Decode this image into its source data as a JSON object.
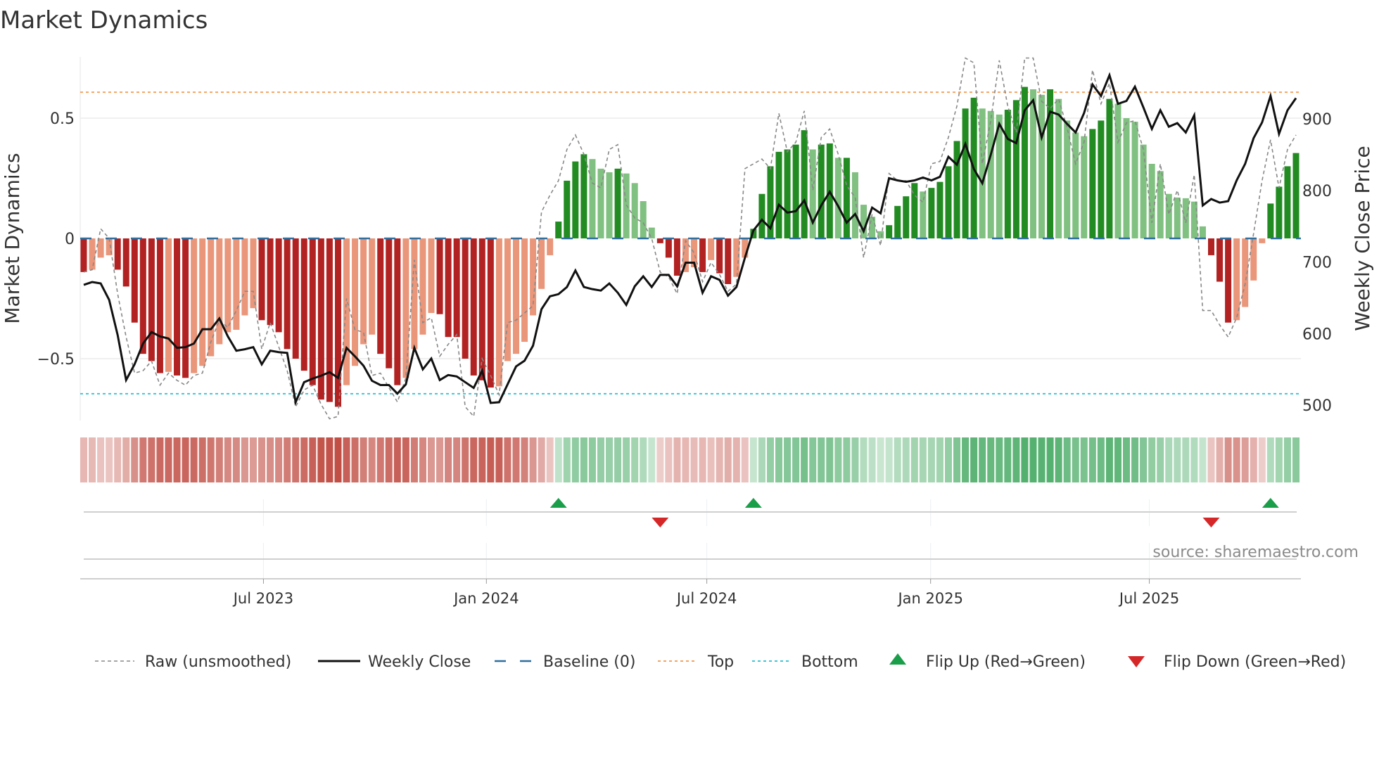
{
  "chart_data": {
    "type": "bar",
    "title": "Market Dynamics",
    "ylabel": "Market Dynamics",
    "y2label": "Weekly Close Price",
    "ylim": [
      -0.755,
      0.755
    ],
    "y2lim": [
      487,
      1035
    ],
    "yticks": [
      {
        "value": 0.5,
        "label": "0.5"
      },
      {
        "value": 0,
        "label": "0"
      },
      {
        "value": -0.5,
        "label": "−0.5"
      }
    ],
    "y2ticks": [
      {
        "value": 900,
        "label": "900"
      },
      {
        "value": 800,
        "label": "800"
      },
      {
        "value": 700,
        "label": "700"
      },
      {
        "value": 600,
        "label": "600"
      },
      {
        "value": 500,
        "label": "500"
      }
    ],
    "xticks": [
      {
        "week": 21.2,
        "label": "Jul 2023"
      },
      {
        "week": 47.5,
        "label": "Jan 2024"
      },
      {
        "week": 73.5,
        "label": "Jul 2024"
      },
      {
        "week": 99.9,
        "label": "Jan 2025"
      },
      {
        "week": 125.7,
        "label": "Jul 2025"
      }
    ],
    "top_level": 0.608,
    "bottom_level": -0.646,
    "baseline": 0,
    "values": [
      -0.14,
      -0.13,
      -0.08,
      -0.07,
      -0.13,
      -0.2,
      -0.35,
      -0.48,
      -0.51,
      -0.56,
      -0.555,
      -0.57,
      -0.58,
      -0.56,
      -0.53,
      -0.49,
      -0.44,
      -0.39,
      -0.38,
      -0.32,
      -0.29,
      -0.34,
      -0.36,
      -0.39,
      -0.46,
      -0.5,
      -0.55,
      -0.61,
      -0.67,
      -0.68,
      -0.7,
      -0.61,
      -0.53,
      -0.44,
      -0.4,
      -0.48,
      -0.54,
      -0.61,
      -0.58,
      -0.46,
      -0.4,
      -0.31,
      -0.315,
      -0.41,
      -0.41,
      -0.5,
      -0.57,
      -0.59,
      -0.62,
      -0.615,
      -0.51,
      -0.48,
      -0.43,
      -0.32,
      -0.21,
      -0.07,
      0.07,
      0.24,
      0.32,
      0.35,
      0.33,
      0.29,
      0.275,
      0.29,
      0.27,
      0.23,
      0.155,
      0.045,
      -0.02,
      -0.08,
      -0.155,
      -0.14,
      -0.12,
      -0.14,
      -0.09,
      -0.145,
      -0.19,
      -0.16,
      -0.08,
      0.04,
      0.185,
      0.3,
      0.36,
      0.37,
      0.39,
      0.45,
      0.37,
      0.39,
      0.395,
      0.335,
      0.335,
      0.275,
      0.14,
      0.09,
      0.03,
      0.055,
      0.135,
      0.175,
      0.23,
      0.195,
      0.21,
      0.235,
      0.3,
      0.405,
      0.54,
      0.585,
      0.54,
      0.53,
      0.515,
      0.535,
      0.575,
      0.63,
      0.62,
      0.597,
      0.62,
      0.58,
      0.49,
      0.44,
      0.425,
      0.455,
      0.49,
      0.58,
      0.56,
      0.5,
      0.485,
      0.39,
      0.31,
      0.28,
      0.185,
      0.17,
      0.167,
      0.153,
      0.05,
      -0.07,
      -0.18,
      -0.35,
      -0.34,
      -0.285,
      -0.175,
      -0.02,
      0.145,
      0.215,
      0.3,
      0.355
    ],
    "raw": [
      -0.14,
      -0.13,
      0.04,
      0.0,
      -0.23,
      -0.41,
      -0.56,
      -0.55,
      -0.51,
      -0.61,
      -0.56,
      -0.59,
      -0.61,
      -0.57,
      -0.56,
      -0.43,
      -0.34,
      -0.37,
      -0.3,
      -0.22,
      -0.22,
      -0.46,
      -0.35,
      -0.45,
      -0.55,
      -0.7,
      -0.63,
      -0.61,
      -0.69,
      -0.75,
      -0.74,
      -0.25,
      -0.38,
      -0.39,
      -0.57,
      -0.56,
      -0.62,
      -0.68,
      -0.58,
      -0.09,
      -0.35,
      -0.33,
      -0.49,
      -0.44,
      -0.4,
      -0.7,
      -0.74,
      -0.5,
      -0.57,
      -0.65,
      -0.35,
      -0.34,
      -0.31,
      -0.28,
      0.11,
      0.18,
      0.24,
      0.37,
      0.43,
      0.35,
      0.23,
      0.21,
      0.37,
      0.39,
      0.14,
      0.085,
      0.065,
      0.0,
      -0.14,
      -0.16,
      -0.23,
      -0.01,
      -0.06,
      -0.18,
      -0.1,
      -0.15,
      -0.22,
      -0.19,
      0.29,
      0.31,
      0.33,
      0.29,
      0.52,
      0.36,
      0.4,
      0.53,
      0.2,
      0.42,
      0.455,
      0.35,
      0.22,
      0.17,
      -0.08,
      0.1,
      -0.03,
      0.27,
      0.24,
      0.24,
      0.18,
      0.15,
      0.31,
      0.32,
      0.42,
      0.55,
      0.75,
      0.73,
      0.31,
      0.49,
      0.74,
      0.55,
      0.44,
      0.75,
      0.75,
      0.57,
      0.54,
      0.58,
      0.46,
      0.31,
      0.4,
      0.7,
      0.56,
      0.645,
      0.4,
      0.48,
      0.49,
      0.37,
      0.065,
      0.31,
      0.1,
      0.2,
      0.065,
      0.265,
      -0.3,
      -0.3,
      -0.36,
      -0.41,
      -0.33,
      -0.19,
      0.02,
      0.24,
      0.41,
      0.21,
      0.37,
      0.43
    ],
    "weekly_close": [
      668,
      672,
      670,
      647,
      598,
      535,
      557,
      586,
      602,
      596,
      593,
      580,
      581,
      586,
      606,
      606,
      621,
      596,
      576,
      578,
      581,
      557,
      576,
      574,
      573,
      504,
      532,
      537,
      541,
      546,
      538,
      580,
      568,
      555,
      534,
      528,
      528,
      516,
      529,
      580,
      550,
      565,
      535,
      542,
      540,
      532,
      524,
      548,
      503,
      504,
      529,
      554,
      562,
      583,
      634,
      652,
      655,
      665,
      688,
      665,
      662,
      660,
      670,
      657,
      640,
      666,
      680,
      665,
      682,
      682,
      666,
      699,
      699,
      657,
      680,
      675,
      653,
      665,
      706,
      744,
      759,
      747,
      780,
      769,
      771,
      786,
      755,
      779,
      798,
      778,
      755,
      767,
      743,
      776,
      768,
      817,
      814,
      812,
      814,
      818,
      814,
      819,
      847,
      836,
      865,
      830,
      810,
      850,
      893,
      872,
      866,
      912,
      926,
      874,
      910,
      906,
      893,
      881,
      908,
      948,
      932,
      961,
      921,
      925,
      945,
      916,
      886,
      912,
      889,
      894,
      881,
      905,
      779,
      788,
      783,
      785,
      814,
      837,
      873,
      895,
      932,
      879,
      912,
      929
    ],
    "flips": [
      {
        "week": 57,
        "type": "up"
      },
      {
        "week": 69,
        "type": "down"
      },
      {
        "week": 80,
        "type": "up"
      },
      {
        "week": 134,
        "type": "down"
      },
      {
        "week": 141,
        "type": "up"
      }
    ],
    "legend": {
      "placement": "bottom",
      "items": [
        {
          "key": "raw",
          "label": "Raw (unsmoothed)"
        },
        {
          "key": "close",
          "label": "Weekly Close"
        },
        {
          "key": "baseline",
          "label": "Baseline (0)"
        },
        {
          "key": "top",
          "label": "Top"
        },
        {
          "key": "bottom",
          "label": "Bottom"
        },
        {
          "key": "flip_up",
          "label": "Flip Up (Red→Green)"
        },
        {
          "key": "flip_down",
          "label": "Flip Down (Green→Red)"
        }
      ]
    },
    "colors": {
      "neg_strong": "#b22222",
      "neg_weak": "#e9967a",
      "pos_strong": "#228b22",
      "pos_weak": "#80c080",
      "baseline": "#2f6f9f",
      "top": "#f4a460",
      "bottom": "#3ec6d6",
      "close": "#111111",
      "raw": "#888888",
      "flip_up": "#1a9e4a",
      "flip_down": "#d62728"
    }
  },
  "source": "source: sharemaestro.com"
}
